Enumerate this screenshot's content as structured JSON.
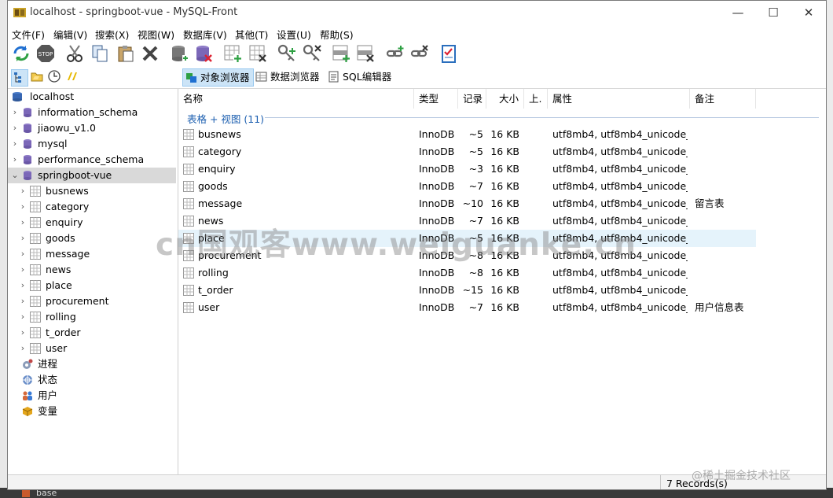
{
  "window": {
    "title": "localhost - springboot-vue - MySQL-Front"
  },
  "menu": [
    "文件(F)",
    "编辑(V)",
    "搜索(X)",
    "视图(W)",
    "数据库(V)",
    "其他(T)",
    "设置(U)",
    "帮助(S)"
  ],
  "toolbar": [
    {
      "name": "refresh-icon"
    },
    {
      "name": "stop-icon"
    },
    {
      "name": "cut-icon"
    },
    {
      "name": "copy-icon"
    },
    {
      "name": "paste-icon"
    },
    {
      "name": "delete-icon"
    },
    {
      "name": "add-database-icon"
    },
    {
      "name": "drop-database-icon"
    },
    {
      "name": "add-table-icon"
    },
    {
      "name": "drop-table-icon"
    },
    {
      "name": "add-key-icon"
    },
    {
      "name": "drop-key-icon"
    },
    {
      "name": "add-field-icon"
    },
    {
      "name": "drop-field-icon"
    },
    {
      "name": "add-link-icon"
    },
    {
      "name": "drop-link-icon"
    },
    {
      "name": "checklist-icon"
    }
  ],
  "view_tabs": [
    {
      "label": "对象浏览器",
      "active": true
    },
    {
      "label": "数据浏览器",
      "active": false
    },
    {
      "label": "SQL编辑器",
      "active": false
    }
  ],
  "tree": [
    {
      "label": "localhost",
      "icon": "server-icon",
      "level": 0,
      "arrow": ""
    },
    {
      "label": "information_schema",
      "icon": "db-icon",
      "level": 1,
      "arrow": "›"
    },
    {
      "label": "jiaowu_v1.0",
      "icon": "db-icon",
      "level": 1,
      "arrow": "›"
    },
    {
      "label": "mysql",
      "icon": "db-icon",
      "level": 1,
      "arrow": "›"
    },
    {
      "label": "performance_schema",
      "icon": "db-icon",
      "level": 1,
      "arrow": "›"
    },
    {
      "label": "springboot-vue",
      "icon": "db-icon",
      "level": 1,
      "arrow": "⌄",
      "selected": true
    },
    {
      "label": "busnews",
      "icon": "table-icon",
      "level": 2,
      "arrow": "›"
    },
    {
      "label": "category",
      "icon": "table-icon",
      "level": 2,
      "arrow": "›"
    },
    {
      "label": "enquiry",
      "icon": "table-icon",
      "level": 2,
      "arrow": "›"
    },
    {
      "label": "goods",
      "icon": "table-icon",
      "level": 2,
      "arrow": "›"
    },
    {
      "label": "message",
      "icon": "table-icon",
      "level": 2,
      "arrow": "›"
    },
    {
      "label": "news",
      "icon": "table-icon",
      "level": 2,
      "arrow": "›"
    },
    {
      "label": "place",
      "icon": "table-icon",
      "level": 2,
      "arrow": "›"
    },
    {
      "label": "procurement",
      "icon": "table-icon",
      "level": 2,
      "arrow": "›"
    },
    {
      "label": "rolling",
      "icon": "table-icon",
      "level": 2,
      "arrow": "›"
    },
    {
      "label": "t_order",
      "icon": "table-icon",
      "level": 2,
      "arrow": "›"
    },
    {
      "label": "user",
      "icon": "table-icon",
      "level": 2,
      "arrow": "›"
    },
    {
      "label": "进程",
      "icon": "process-icon",
      "level": 1,
      "arrow": ""
    },
    {
      "label": "状态",
      "icon": "status-icon",
      "level": 1,
      "arrow": ""
    },
    {
      "label": "用户",
      "icon": "users-icon",
      "level": 1,
      "arrow": ""
    },
    {
      "label": "变量",
      "icon": "variables-icon",
      "level": 1,
      "arrow": ""
    }
  ],
  "list": {
    "columns": [
      "名称",
      "类型",
      "记录",
      "大小",
      "上.",
      "属性",
      "备注"
    ],
    "group_label": "表格 + 视图 (11)",
    "rows": [
      {
        "name": "busnews",
        "type": "InnoDB",
        "records": "~5",
        "size": "16 KB",
        "attr": "utf8mb4, utf8mb4_unicode_ci",
        "comment": ""
      },
      {
        "name": "category",
        "type": "InnoDB",
        "records": "~5",
        "size": "16 KB",
        "attr": "utf8mb4, utf8mb4_unicode_ci",
        "comment": ""
      },
      {
        "name": "enquiry",
        "type": "InnoDB",
        "records": "~3",
        "size": "16 KB",
        "attr": "utf8mb4, utf8mb4_unicode_ci",
        "comment": ""
      },
      {
        "name": "goods",
        "type": "InnoDB",
        "records": "~7",
        "size": "16 KB",
        "attr": "utf8mb4, utf8mb4_unicode_ci",
        "comment": ""
      },
      {
        "name": "message",
        "type": "InnoDB",
        "records": "~10",
        "size": "16 KB",
        "attr": "utf8mb4, utf8mb4_unicode_ci",
        "comment": "留言表"
      },
      {
        "name": "news",
        "type": "InnoDB",
        "records": "~7",
        "size": "16 KB",
        "attr": "utf8mb4, utf8mb4_unicode_ci",
        "comment": ""
      },
      {
        "name": "place",
        "type": "InnoDB",
        "records": "~5",
        "size": "16 KB",
        "attr": "utf8mb4, utf8mb4_unicode_ci",
        "comment": "",
        "highlight": true
      },
      {
        "name": "procurement",
        "type": "InnoDB",
        "records": "~8",
        "size": "16 KB",
        "attr": "utf8mb4, utf8mb4_unicode_ci",
        "comment": ""
      },
      {
        "name": "rolling",
        "type": "InnoDB",
        "records": "~8",
        "size": "16 KB",
        "attr": "utf8mb4, utf8mb4_unicode_ci",
        "comment": ""
      },
      {
        "name": "t_order",
        "type": "InnoDB",
        "records": "~15",
        "size": "16 KB",
        "attr": "utf8mb4, utf8mb4_unicode_ci",
        "comment": ""
      },
      {
        "name": "user",
        "type": "InnoDB",
        "records": "~7",
        "size": "16 KB",
        "attr": "utf8mb4, utf8mb4_unicode_ci",
        "comment": "用户信息表"
      }
    ]
  },
  "status": {
    "records": "7 Records(s)"
  },
  "watermark": {
    "main": "cn国观客www.weiguanke.cn",
    "corner": "@稀土掘金技术社区"
  },
  "background": {
    "taskbar_label": "base"
  },
  "colors": {
    "accent": "#1c5fb0",
    "selection": "#cce4f7",
    "row_highlight": "#e5f3fb"
  }
}
